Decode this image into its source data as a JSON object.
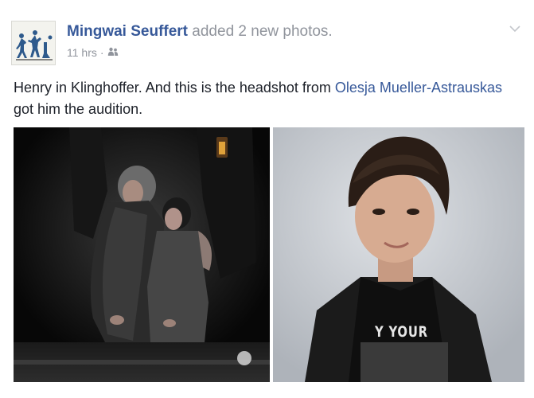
{
  "post": {
    "author_name": "Mingwai Seuffert",
    "action_text": "added 2 new photos.",
    "timestamp": "11 hrs",
    "separator": "·",
    "audience_icon": "friends-icon",
    "text_before_mention": "Henry in Klinghoffer. And this is the headshot from ",
    "mention": "Olesja Mueller-Astrauskas",
    "text_after_mention": " got him the audition.",
    "photos": [
      {
        "shirt_text": ""
      },
      {
        "shirt_text": "Y YOUR"
      }
    ]
  },
  "colors": {
    "link": "#365899",
    "muted": "#90949c",
    "body_text": "#1d2129"
  },
  "icons": {
    "options": "chevron-down-icon",
    "avatar": "profile-picture"
  }
}
